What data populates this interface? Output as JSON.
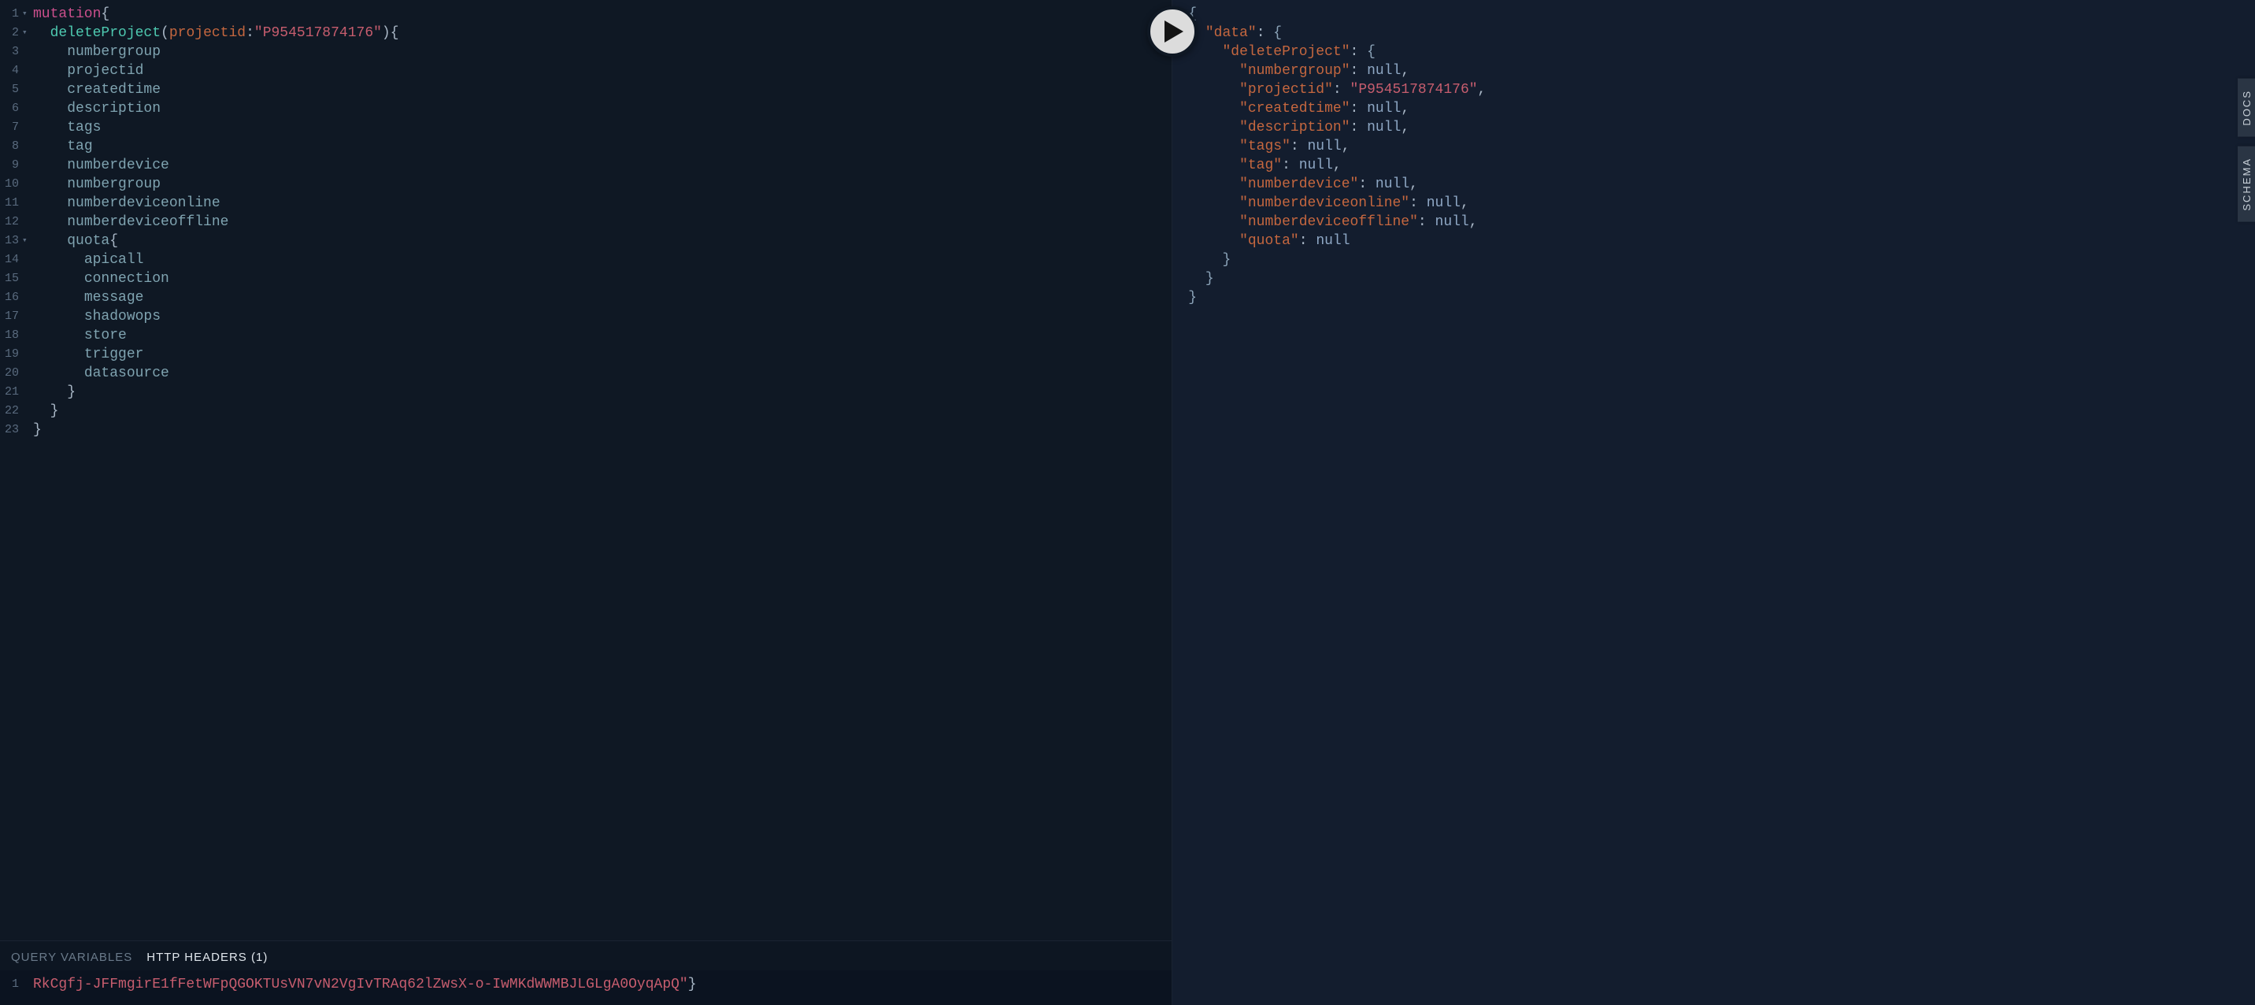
{
  "query": {
    "lines": [
      {
        "n": 1,
        "fold": "▾",
        "tokens": [
          [
            "keyword",
            "mutation"
          ],
          [
            "punct",
            "{"
          ]
        ]
      },
      {
        "n": 2,
        "fold": "▾",
        "tokens": [
          [
            "",
            "  "
          ],
          [
            "def",
            "deleteProject"
          ],
          [
            "punct",
            "("
          ],
          [
            "arg",
            "projectid"
          ],
          [
            "punct",
            ":"
          ],
          [
            "str",
            "\"P954517874176\""
          ],
          [
            "punct",
            "){"
          ]
        ]
      },
      {
        "n": 3,
        "fold": "",
        "tokens": [
          [
            "",
            "    "
          ],
          [
            "field",
            "numbergroup"
          ]
        ]
      },
      {
        "n": 4,
        "fold": "",
        "tokens": [
          [
            "",
            "    "
          ],
          [
            "field",
            "projectid"
          ]
        ]
      },
      {
        "n": 5,
        "fold": "",
        "tokens": [
          [
            "",
            "    "
          ],
          [
            "field",
            "createdtime"
          ]
        ]
      },
      {
        "n": 6,
        "fold": "",
        "tokens": [
          [
            "",
            "    "
          ],
          [
            "field",
            "description"
          ]
        ]
      },
      {
        "n": 7,
        "fold": "",
        "tokens": [
          [
            "",
            "    "
          ],
          [
            "field",
            "tags"
          ]
        ]
      },
      {
        "n": 8,
        "fold": "",
        "tokens": [
          [
            "",
            "    "
          ],
          [
            "field",
            "tag"
          ]
        ]
      },
      {
        "n": 9,
        "fold": "",
        "tokens": [
          [
            "",
            "    "
          ],
          [
            "field",
            "numberdevice"
          ]
        ]
      },
      {
        "n": 10,
        "fold": "",
        "tokens": [
          [
            "",
            "    "
          ],
          [
            "field",
            "numbergroup"
          ]
        ]
      },
      {
        "n": 11,
        "fold": "",
        "tokens": [
          [
            "",
            "    "
          ],
          [
            "field",
            "numberdeviceonline"
          ]
        ]
      },
      {
        "n": 12,
        "fold": "",
        "tokens": [
          [
            "",
            "    "
          ],
          [
            "field",
            "numberdeviceoffline"
          ]
        ]
      },
      {
        "n": 13,
        "fold": "▾",
        "tokens": [
          [
            "",
            "    "
          ],
          [
            "field",
            "quota"
          ],
          [
            "punct",
            "{"
          ]
        ]
      },
      {
        "n": 14,
        "fold": "",
        "tokens": [
          [
            "",
            "      "
          ],
          [
            "field",
            "apicall"
          ]
        ]
      },
      {
        "n": 15,
        "fold": "",
        "tokens": [
          [
            "",
            "      "
          ],
          [
            "field",
            "connection"
          ]
        ]
      },
      {
        "n": 16,
        "fold": "",
        "tokens": [
          [
            "",
            "      "
          ],
          [
            "field",
            "message"
          ]
        ]
      },
      {
        "n": 17,
        "fold": "",
        "tokens": [
          [
            "",
            "      "
          ],
          [
            "field",
            "shadowops"
          ]
        ]
      },
      {
        "n": 18,
        "fold": "",
        "tokens": [
          [
            "",
            "      "
          ],
          [
            "field",
            "store"
          ]
        ]
      },
      {
        "n": 19,
        "fold": "",
        "tokens": [
          [
            "",
            "      "
          ],
          [
            "field",
            "trigger"
          ]
        ]
      },
      {
        "n": 20,
        "fold": "",
        "tokens": [
          [
            "",
            "      "
          ],
          [
            "field",
            "datasource"
          ]
        ]
      },
      {
        "n": 21,
        "fold": "",
        "tokens": [
          [
            "",
            "    "
          ],
          [
            "punct",
            "}"
          ]
        ]
      },
      {
        "n": 22,
        "fold": "",
        "tokens": [
          [
            "",
            "  "
          ],
          [
            "punct",
            "}"
          ]
        ]
      },
      {
        "n": 23,
        "fold": "",
        "tokens": [
          [
            "",
            ""
          ],
          [
            "punct",
            "}"
          ]
        ]
      }
    ]
  },
  "bottom": {
    "tabs": {
      "variables": "QUERY VARIABLES",
      "headers": "HTTP HEADERS (1)"
    },
    "activeTab": "headers",
    "editorLine": {
      "n": 1,
      "tokens": [
        [
          "str",
          "RkCgfj-JFFmgirE1fFetWFpQGOKTUsVN7vN2VgIvTRAq62lZwsX-o-IwMKdWWMBJLGLgA0OyqApQ\""
        ],
        [
          "punct",
          "}"
        ]
      ]
    }
  },
  "response": {
    "lines": [
      {
        "fold": "▾",
        "tokens": [
          [
            "brace",
            "{"
          ]
        ]
      },
      {
        "fold": "▾",
        "tokens": [
          [
            "",
            "  "
          ],
          [
            "prop",
            "\"data\""
          ],
          [
            "punct",
            ": "
          ],
          [
            "brace",
            "{"
          ]
        ]
      },
      {
        "fold": "▾",
        "tokens": [
          [
            "",
            "    "
          ],
          [
            "prop",
            "\"deleteProject\""
          ],
          [
            "punct",
            ": "
          ],
          [
            "brace",
            "{"
          ]
        ]
      },
      {
        "fold": "",
        "tokens": [
          [
            "",
            "      "
          ],
          [
            "prop",
            "\"numbergroup\""
          ],
          [
            "punct",
            ": "
          ],
          [
            "null",
            "null"
          ],
          [
            "punct",
            ","
          ]
        ]
      },
      {
        "fold": "",
        "tokens": [
          [
            "",
            "      "
          ],
          [
            "prop",
            "\"projectid\""
          ],
          [
            "punct",
            ": "
          ],
          [
            "str",
            "\"P954517874176\""
          ],
          [
            "punct",
            ","
          ]
        ]
      },
      {
        "fold": "",
        "tokens": [
          [
            "",
            "      "
          ],
          [
            "prop",
            "\"createdtime\""
          ],
          [
            "punct",
            ": "
          ],
          [
            "null",
            "null"
          ],
          [
            "punct",
            ","
          ]
        ]
      },
      {
        "fold": "",
        "tokens": [
          [
            "",
            "      "
          ],
          [
            "prop",
            "\"description\""
          ],
          [
            "punct",
            ": "
          ],
          [
            "null",
            "null"
          ],
          [
            "punct",
            ","
          ]
        ]
      },
      {
        "fold": "",
        "tokens": [
          [
            "",
            "      "
          ],
          [
            "prop",
            "\"tags\""
          ],
          [
            "punct",
            ": "
          ],
          [
            "null",
            "null"
          ],
          [
            "punct",
            ","
          ]
        ]
      },
      {
        "fold": "",
        "tokens": [
          [
            "",
            "      "
          ],
          [
            "prop",
            "\"tag\""
          ],
          [
            "punct",
            ": "
          ],
          [
            "null",
            "null"
          ],
          [
            "punct",
            ","
          ]
        ]
      },
      {
        "fold": "",
        "tokens": [
          [
            "",
            "      "
          ],
          [
            "prop",
            "\"numberdevice\""
          ],
          [
            "punct",
            ": "
          ],
          [
            "null",
            "null"
          ],
          [
            "punct",
            ","
          ]
        ]
      },
      {
        "fold": "",
        "tokens": [
          [
            "",
            "      "
          ],
          [
            "prop",
            "\"numberdeviceonline\""
          ],
          [
            "punct",
            ": "
          ],
          [
            "null",
            "null"
          ],
          [
            "punct",
            ","
          ]
        ]
      },
      {
        "fold": "",
        "tokens": [
          [
            "",
            "      "
          ],
          [
            "prop",
            "\"numberdeviceoffline\""
          ],
          [
            "punct",
            ": "
          ],
          [
            "null",
            "null"
          ],
          [
            "punct",
            ","
          ]
        ]
      },
      {
        "fold": "",
        "tokens": [
          [
            "",
            "      "
          ],
          [
            "prop",
            "\"quota\""
          ],
          [
            "punct",
            ": "
          ],
          [
            "null",
            "null"
          ]
        ]
      },
      {
        "fold": "",
        "tokens": [
          [
            "",
            "    "
          ],
          [
            "brace",
            "}"
          ]
        ]
      },
      {
        "fold": "",
        "tokens": [
          [
            "",
            "  "
          ],
          [
            "brace",
            "}"
          ]
        ]
      },
      {
        "fold": "",
        "tokens": [
          [
            "brace",
            "}"
          ]
        ]
      }
    ]
  },
  "sideTabs": {
    "docs": "DOCS",
    "schema": "SCHEMA"
  }
}
